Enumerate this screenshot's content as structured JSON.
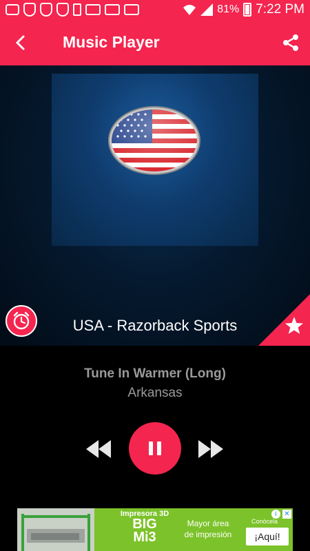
{
  "status_bar": {
    "battery": "81%",
    "time": "7:22 PM"
  },
  "app_bar": {
    "title": "Music Player"
  },
  "hero": {
    "station_name": "USA - Razorback Sports",
    "flag_icon": "usa-flag-icon"
  },
  "now_playing": {
    "song": "Tune In Warmer (Long)",
    "artist": "Arkansas"
  },
  "ad": {
    "line1": "Impresora 3D",
    "line2": "BIG",
    "line3": "Mi3",
    "text_a": "Mayor área",
    "text_b": "de impresión",
    "conoce": "Conócela",
    "cta": "¡Aquí!"
  },
  "colors": {
    "accent": "#f4254f",
    "hero_bg": "#051a30",
    "muted_text": "#9a9a9a"
  }
}
